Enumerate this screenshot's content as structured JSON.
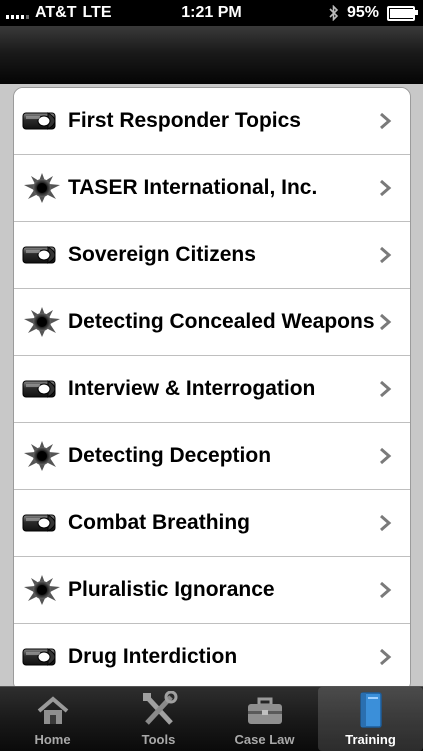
{
  "status_bar": {
    "carrier": "AT&T",
    "network": "LTE",
    "time": "1:21 PM",
    "battery": "95%",
    "battery_level": 0.95,
    "icons": [
      "signal-icon",
      "bluetooth-icon",
      "battery-icon"
    ]
  },
  "navbar": {
    "title": ""
  },
  "list": {
    "items": [
      {
        "label": "First Responder Topics",
        "icon": "bullet-icon"
      },
      {
        "label": "TASER International, Inc.",
        "icon": "bullet-hole-icon"
      },
      {
        "label": "Sovereign Citizens",
        "icon": "bullet-icon"
      },
      {
        "label": "Detecting Concealed Weapons",
        "icon": "bullet-hole-icon"
      },
      {
        "label": "Interview & Interrogation",
        "icon": "bullet-icon"
      },
      {
        "label": "Detecting Deception",
        "icon": "bullet-hole-icon"
      },
      {
        "label": "Combat Breathing",
        "icon": "bullet-icon"
      },
      {
        "label": "Pluralistic Ignorance",
        "icon": "bullet-hole-icon"
      },
      {
        "label": "Drug Interdiction",
        "icon": "bullet-icon"
      }
    ]
  },
  "tabbar": {
    "tabs": [
      {
        "label": "Home",
        "icon": "home-icon",
        "active": false
      },
      {
        "label": "Tools",
        "icon": "tools-icon",
        "active": false
      },
      {
        "label": "Case Law",
        "icon": "briefcase-icon",
        "active": false
      },
      {
        "label": "Training",
        "icon": "book-icon",
        "active": true
      }
    ]
  },
  "colors": {
    "background": "#c8c8c8",
    "tab_active_label": "#ffffff",
    "tab_inactive_label": "#a9a9a9"
  }
}
